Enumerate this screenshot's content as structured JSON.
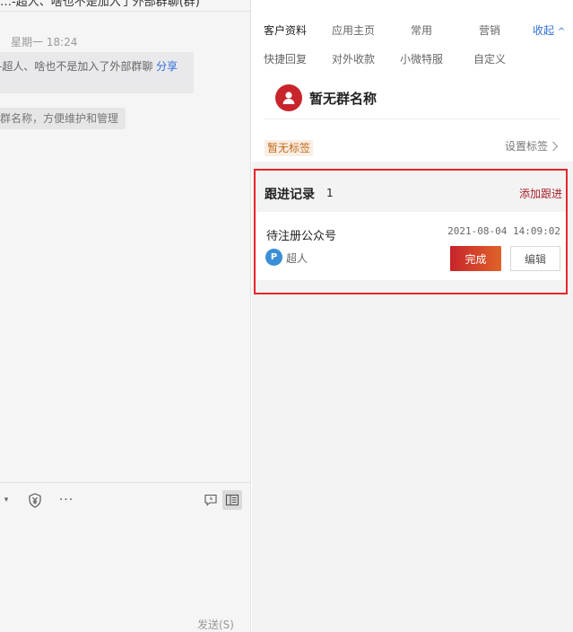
{
  "chat": {
    "title": "…-超人、啥也不是加入了外部群聊(群)",
    "message_time": "星期一 18:24",
    "message_text": "-超人、啥也不是加入了外部群聊",
    "message_link": "分享",
    "system_tip": "群名称，方便维护和管理",
    "send_label": "发送(S)"
  },
  "toolbar": {
    "caret": "▾",
    "pay_icon": "yuan-shield-icon",
    "more": "···",
    "chat_icon": "chat-time-icon",
    "panel_icon": "side-panel-icon"
  },
  "tabs": {
    "row1": [
      "客户资料",
      "应用主页",
      "常用",
      "营销"
    ],
    "collapse": "收起",
    "row2": [
      "快捷回复",
      "对外收款",
      "小微特服",
      "自定义"
    ]
  },
  "customer": {
    "name": "暂无群名称",
    "tag": "暂无标签",
    "set_tag": "设置标签"
  },
  "follow": {
    "title": "跟进记录",
    "count": "1",
    "add": "添加跟进",
    "item_title": "待注册公众号",
    "item_time": "2021-08-04 14:09:02",
    "owner": "超人",
    "owner_initial": "P",
    "done": "完成",
    "edit": "编辑"
  },
  "colors": {
    "accent_red": "#c8242b",
    "link_blue": "#2f6fd6",
    "highlight_border": "#e8262a"
  }
}
